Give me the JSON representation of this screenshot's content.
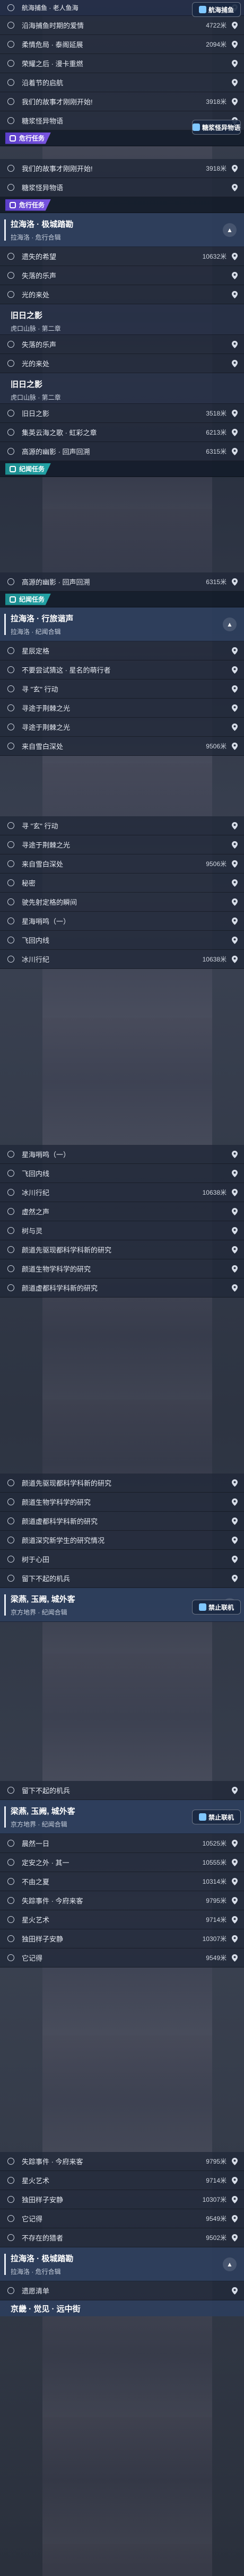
{
  "panels": [
    {
      "id": "p1",
      "rows": [
        {
          "label": "航海捕鱼 · 老人鱼海",
          "dist": "",
          "first": true
        },
        {
          "label": "沿海捕鱼时期的爱情",
          "dist": "4722米"
        },
        {
          "label": "柔情危局 · 泰阁延展",
          "dist": "2094米"
        },
        {
          "label": "荣耀之后 · 漫卡重燃",
          "dist": ""
        },
        {
          "label": "沿着节的启航",
          "dist": ""
        },
        {
          "label": "我们的故事才刚刚开始!",
          "dist": "3918米"
        },
        {
          "label": "糖浆怪异物语",
          "dist": ""
        }
      ],
      "badges": [
        {
          "label": "航海捕鱼"
        },
        {
          "label": "糖浆怪异物语"
        }
      ]
    }
  ],
  "section_tags": {
    "side": "危行任务",
    "world": "纪闻任务"
  },
  "block_a": {
    "rows_top": [
      {
        "label": "我们的故事才刚刚开始!",
        "dist": "3918米"
      },
      {
        "label": "糖浆怪异物语",
        "dist": ""
      }
    ],
    "quest": {
      "title": "拉海洛 · 极城踏勘",
      "sub": "拉海洛 · 危行合辑"
    },
    "rows": [
      {
        "label": "遗失的希望",
        "dist": "10632米"
      },
      {
        "label": "失落的乐声",
        "dist": ""
      },
      {
        "label": "光的来处",
        "dist": ""
      }
    ],
    "chapter": {
      "title": "旧日之影",
      "sub": "虎口山脉 · 第二章"
    },
    "rows2": [
      {
        "label": "失落的乐声",
        "dist": ""
      },
      {
        "label": "光的来处",
        "dist": ""
      }
    ],
    "chapter2": {
      "title": "旧日之影",
      "sub": "虎口山脉 · 第二章"
    },
    "rows3": [
      {
        "label": "旧日之影",
        "dist": "3518米"
      },
      {
        "label": "集英云海之歌 · 虹彩之章",
        "dist": "6213米"
      },
      {
        "label": "高源的幽影 · 回声回溯",
        "dist": "6315米"
      }
    ]
  },
  "block_b": {
    "rows_top": [
      {
        "label": "高源的幽影 · 回声回溯",
        "dist": "6315米"
      }
    ],
    "quest": {
      "title": "拉海洛 · 行旅谐声",
      "sub": "拉海洛 · 纪闻合辑"
    },
    "rows": [
      {
        "label": "星辰定格",
        "dist": ""
      },
      {
        "label": "不要尝试猜这 · 星名的萌行者",
        "dist": ""
      },
      {
        "label": "寻 \"玄\" 行动",
        "dist": ""
      },
      {
        "label": "寻途于荆棘之光",
        "dist": ""
      },
      {
        "label": "寻途于荆棘之光",
        "dist": ""
      },
      {
        "label": "来自雪白深处",
        "dist": "9506米"
      }
    ]
  },
  "block_c": {
    "rows": [
      {
        "label": "寻 \"玄\" 行动",
        "dist": ""
      },
      {
        "label": "寻途于荆棘之光",
        "dist": ""
      },
      {
        "label": "来自雪白深处",
        "dist": "9506米"
      },
      {
        "label": "秘密",
        "dist": ""
      },
      {
        "label": "驶先射定格的瞬间",
        "dist": ""
      },
      {
        "label": "星海哨鸣（一）",
        "dist": ""
      },
      {
        "label": "飞回内线",
        "dist": ""
      },
      {
        "label": "冰川行纪",
        "dist": "10638米"
      }
    ]
  },
  "block_d": {
    "rows": [
      {
        "label": "星海哨鸣（一）",
        "dist": ""
      },
      {
        "label": "飞回内线",
        "dist": ""
      },
      {
        "label": "冰川行纪",
        "dist": "10638米"
      },
      {
        "label": "虚然之声",
        "dist": ""
      },
      {
        "label": "树与灵",
        "dist": ""
      },
      {
        "label": "颜道先驱现都科学科新的研究",
        "dist": ""
      },
      {
        "label": "颜道生物学科学的研究",
        "dist": ""
      },
      {
        "label": "颜道虚都科学科新的研究",
        "dist": ""
      }
    ]
  },
  "block_e": {
    "rows": [
      {
        "label": "颜道先驱现都科学科新的研究",
        "dist": ""
      },
      {
        "label": "颜道生物学科学的研究",
        "dist": ""
      },
      {
        "label": "颜道虚都科学科新的研究",
        "dist": ""
      },
      {
        "label": "颜道深究新学生的研究情况",
        "dist": ""
      },
      {
        "label": "树于心田",
        "dist": ""
      },
      {
        "label": "留下不起的机兵",
        "dist": ""
      }
    ],
    "quest": {
      "title": "梁燕, 玉阙, 城外客",
      "sub": "京方地界 · 纪闻合辑"
    },
    "badge": "禁止联机"
  },
  "block_f": {
    "rows_top": [
      {
        "label": "留下不起的机兵",
        "dist": ""
      }
    ],
    "quest": {
      "title": "梁燕, 玉阙, 城外客",
      "sub": "京方地界 · 纪闻合辑"
    },
    "badge": "禁止联机",
    "rows": [
      {
        "label": "晨然一日",
        "dist": "10525米"
      },
      {
        "label": "定安之外 · 其一",
        "dist": "10555米"
      },
      {
        "label": "不由之夏",
        "dist": "10314米"
      },
      {
        "label": "失踪事件 · 今府来客",
        "dist": "9795米"
      },
      {
        "label": "星火艺术",
        "dist": "9714米"
      },
      {
        "label": "独田样子安静",
        "dist": "10307米"
      },
      {
        "label": "它记得",
        "dist": "9549米"
      }
    ]
  },
  "block_g": {
    "rows": [
      {
        "label": "失踪事件 · 今府来客",
        "dist": "9795米"
      },
      {
        "label": "星火艺术",
        "dist": "9714米"
      },
      {
        "label": "独田样子安静",
        "dist": "10307米"
      },
      {
        "label": "它记得",
        "dist": "9549米"
      },
      {
        "label": "不存在的猎者",
        "dist": "9502米"
      }
    ],
    "quest": {
      "title": "拉海洛 · 极城踏勘",
      "sub": "拉海洛 · 危行合辑"
    },
    "rows2": [
      {
        "label": "遗愿清单",
        "dist": ""
      }
    ],
    "peek": "京畿 · 觉见 · 远中街"
  }
}
